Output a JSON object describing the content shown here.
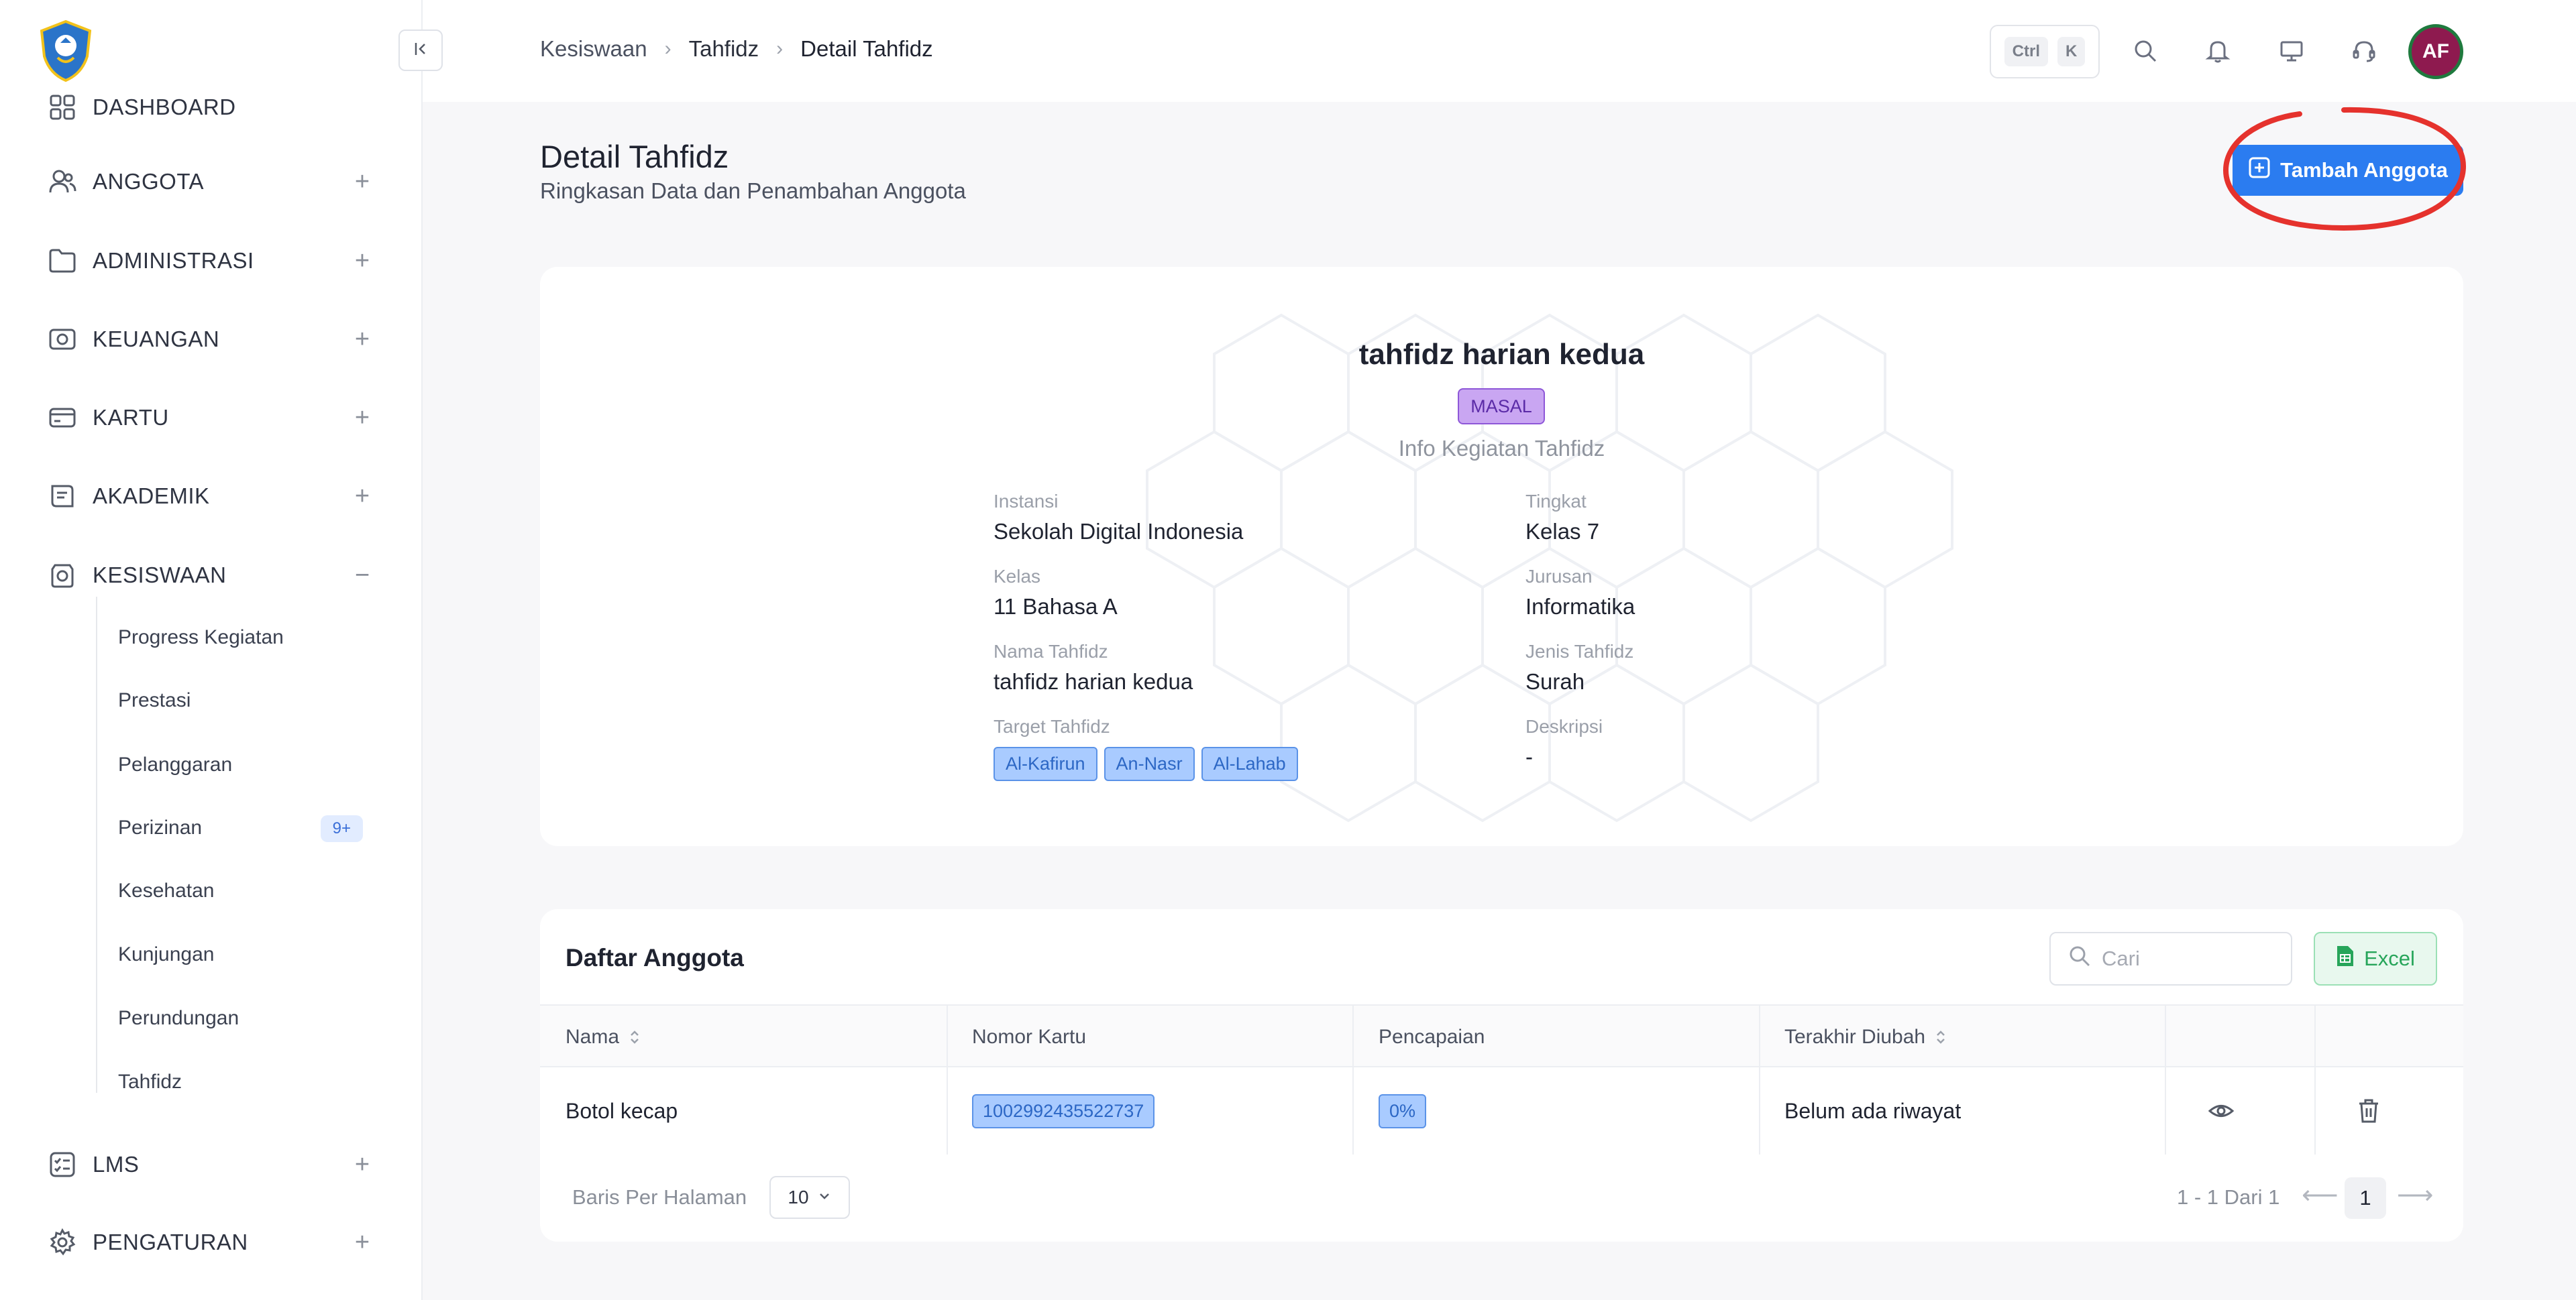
{
  "sidebar": {
    "items": [
      {
        "label": "DASHBOARD"
      },
      {
        "label": "ANGGOTA",
        "toggle": "+"
      },
      {
        "label": "ADMINISTRASI",
        "toggle": "+"
      },
      {
        "label": "KEUANGAN",
        "toggle": "+"
      },
      {
        "label": "KARTU",
        "toggle": "+"
      },
      {
        "label": "AKADEMIK",
        "toggle": "+"
      },
      {
        "label": "KESISWAAN",
        "toggle": "−"
      },
      {
        "label": "LMS",
        "toggle": "+"
      },
      {
        "label": "PENGATURAN",
        "toggle": "+"
      }
    ],
    "sub_items": [
      {
        "label": "Progress Kegiatan"
      },
      {
        "label": "Prestasi"
      },
      {
        "label": "Pelanggaran"
      },
      {
        "label": "Perizinan",
        "badge": "9+"
      },
      {
        "label": "Kesehatan"
      },
      {
        "label": "Kunjungan"
      },
      {
        "label": "Perundungan"
      },
      {
        "label": "Tahfidz"
      }
    ]
  },
  "topbar": {
    "breadcrumb": [
      "Kesiswaan",
      "Tahfidz",
      "Detail Tahfidz"
    ],
    "shortcut": [
      "Ctrl",
      "K"
    ],
    "avatar_initials": "AF",
    "avatar_color": "#8e1a4f"
  },
  "page": {
    "title": "Detail Tahfidz",
    "subtitle": "Ringkasan Data dan Penambahan Anggota",
    "add_button": "Tambah Anggota",
    "accent_color": "#2b7cf0"
  },
  "info": {
    "title": "tahfidz harian kedua",
    "badge": "MASAL",
    "subtitle": "Info Kegiatan Tahfidz",
    "fields": {
      "instansi": {
        "label": "Instansi",
        "value": "Sekolah Digital Indonesia"
      },
      "tingkat": {
        "label": "Tingkat",
        "value": "Kelas 7"
      },
      "kelas": {
        "label": "Kelas",
        "value": "11 Bahasa A"
      },
      "jurusan": {
        "label": "Jurusan",
        "value": "Informatika"
      },
      "nama": {
        "label": "Nama Tahfidz",
        "value": "tahfidz harian kedua"
      },
      "jenis": {
        "label": "Jenis Tahfidz",
        "value": "Surah"
      },
      "target": {
        "label": "Target Tahfidz",
        "tags": [
          "Al-Kafirun",
          "An-Nasr",
          "Al-Lahab"
        ]
      },
      "deskripsi": {
        "label": "Deskripsi",
        "value": "-"
      }
    }
  },
  "members": {
    "title": "Daftar Anggota",
    "search_placeholder": "Cari",
    "excel_label": "Excel",
    "columns": [
      "Nama",
      "Nomor Kartu",
      "Pencapaian",
      "Terakhir Diubah"
    ],
    "rows": [
      {
        "nama": "Botol kecap",
        "nomor_kartu": "1002992435522737",
        "pencapaian": "0%",
        "terakhir_diubah": "Belum ada riwayat"
      }
    ],
    "rows_per_page_label": "Baris Per Halaman",
    "rows_per_page": "10",
    "range_text": "1 - 1 Dari 1",
    "current_page": "1"
  }
}
